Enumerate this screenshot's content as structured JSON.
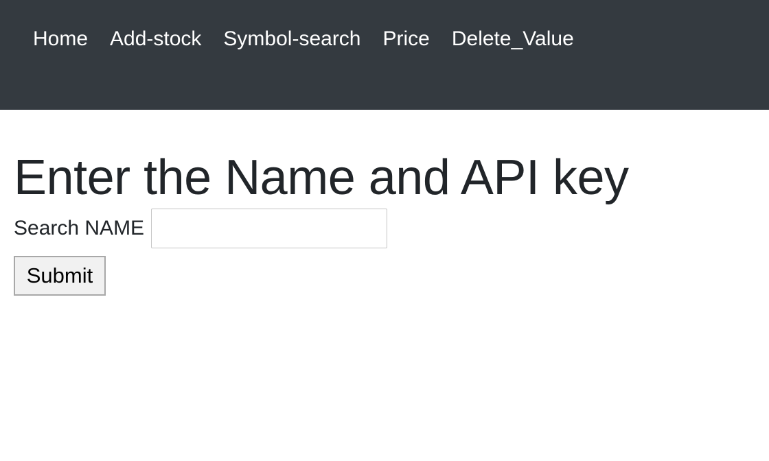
{
  "navbar": {
    "items": [
      {
        "label": "Home"
      },
      {
        "label": "Add-stock"
      },
      {
        "label": "Symbol-search"
      },
      {
        "label": "Price"
      },
      {
        "label": "Delete_Value"
      }
    ]
  },
  "main": {
    "title": "Enter the Name and API key",
    "search_label": "Search NAME",
    "search_value": "",
    "search_placeholder": "",
    "submit_label": "Submit"
  },
  "colors": {
    "navbar_background": "#343a40",
    "nav_text": "#ffffff",
    "page_background": "#ffffff",
    "text": "#212529"
  }
}
